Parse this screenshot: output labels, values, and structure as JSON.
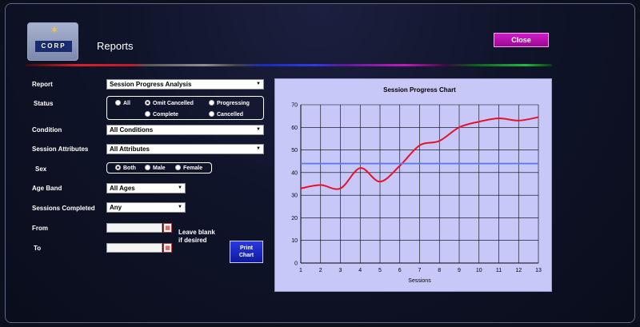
{
  "header": {
    "logo_text": "CORP",
    "title": "Reports",
    "close_label": "Close"
  },
  "form": {
    "report": {
      "label": "Report",
      "value": "Session Progress Analysis"
    },
    "status": {
      "label": "Status",
      "options": [
        "All",
        "Omit Cancelled",
        "Progressing",
        "Complete",
        "Cancelled"
      ],
      "selected": "Omit Cancelled"
    },
    "condition": {
      "label": "Condition",
      "value": "All Conditions"
    },
    "session_attributes": {
      "label": "Session Attributes",
      "value": "All Attributes"
    },
    "sex": {
      "label": "Sex",
      "options": [
        "Both",
        "Male",
        "Female"
      ],
      "selected": "Both"
    },
    "age_band": {
      "label": "Age Band",
      "value": "All Ages"
    },
    "sessions_completed": {
      "label": "Sessions Completed",
      "value": "Any"
    },
    "from": {
      "label": "From",
      "value": ""
    },
    "to": {
      "label": "To",
      "value": ""
    },
    "hint_line1": "Leave blank",
    "hint_line2": "if desired",
    "print_line1": "Print",
    "print_line2": "Chart"
  },
  "chart_data": {
    "type": "line",
    "title": "Session Progress Chart",
    "xlabel": "Sessions",
    "ylabel": "",
    "xlim": [
      1,
      13
    ],
    "ylim": [
      0,
      70
    ],
    "x_ticks": [
      1,
      2,
      3,
      4,
      5,
      6,
      7,
      8,
      9,
      10,
      11,
      12,
      13
    ],
    "y_ticks": [
      0,
      10,
      20,
      30,
      40,
      50,
      60,
      70
    ],
    "grid": true,
    "series": [
      {
        "color": "#e8102a",
        "x": [
          1,
          2,
          3,
          4,
          5,
          6,
          7,
          8,
          9,
          10,
          11,
          12,
          13
        ],
        "y": [
          33,
          34.5,
          33,
          42,
          36,
          43,
          52,
          54,
          60,
          62.5,
          64,
          63,
          64.5
        ]
      },
      {
        "color": "#5a7ee0",
        "x": [
          1,
          13
        ],
        "y": [
          44,
          44
        ]
      }
    ]
  }
}
